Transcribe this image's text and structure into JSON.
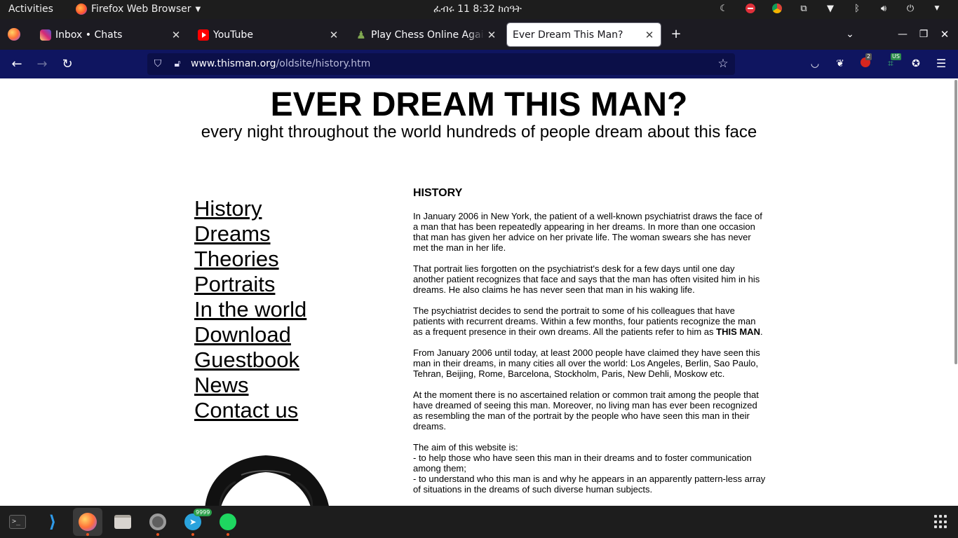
{
  "topbar": {
    "activities": "Activities",
    "app_name": "Firefox Web Browser",
    "clock": "ፈብሩ 11   8:32 ከሰዓት"
  },
  "tabs": [
    {
      "label": "Inbox • Chats",
      "favicon": "instagram-icon"
    },
    {
      "label": "YouTube",
      "favicon": "youtube-icon"
    },
    {
      "label": "Play Chess Online Against",
      "favicon": "chess-pawn-icon"
    },
    {
      "label": "Ever Dream This Man?",
      "favicon": "none",
      "active": true
    }
  ],
  "navbar": {
    "url_host": "www.thisman.org",
    "url_path": "/oldsite/history.htm",
    "ext_badge_count": "2",
    "ext_badge_lang": "US"
  },
  "page": {
    "title": "EVER DREAM THIS MAN?",
    "subtitle": "every night throughout the world hundreds of people dream about this face",
    "menu": [
      "History",
      "Dreams",
      "Theories",
      "Portraits",
      "In the world",
      "Download",
      "Guestbook",
      "News",
      "Contact us"
    ],
    "section_heading": "HISTORY",
    "paragraphs": {
      "p1": "In January 2006 in New York, the patient of a well-known psychiatrist draws the face of a man that has been repeatedly appearing in her dreams. In more than one occasion that man has given her advice on her private life. The woman swears she has never met the man in her life.",
      "p2": "That portrait lies forgotten on the psychiatrist's desk for a few days until one day another patient recognizes that face and says that the man has often visited him in his dreams. He also claims he has never seen that man in his waking life.",
      "p3_before": "The psychiatrist decides to send the portrait to some of his colleagues that have patients with recurrent dreams. Within a few months, four patients recognize the man as a frequent presence in their own dreams. All the patients refer to him as ",
      "p3_bold": "THIS MAN",
      "p3_after": ".",
      "p4": "From January 2006 until today, at least 2000 people have claimed they have seen this man in their dreams, in many cities all over the world: Los Angeles, Berlin, Sao Paulo, Tehran, Beijing, Rome, Barcelona, Stockholm, Paris, New Dehli, Moskow etc.",
      "p5": "At the moment there is no ascertained relation or common trait among the people that have dreamed of seeing this man. Moreover, no living man has ever been recognized as resembling the man of the portrait by the people who have seen this man in their dreams.",
      "p6_intro": "The aim of this website is:",
      "p6_line1": "- to help those who have seen this man in their dreams and to foster communication among them;",
      "p6_line2": "- to understand who this man is and why he appears in an apparently pattern-less array of situations in the dreams of such diverse human subjects."
    }
  },
  "dock": {
    "telegram_badge": "9999"
  }
}
